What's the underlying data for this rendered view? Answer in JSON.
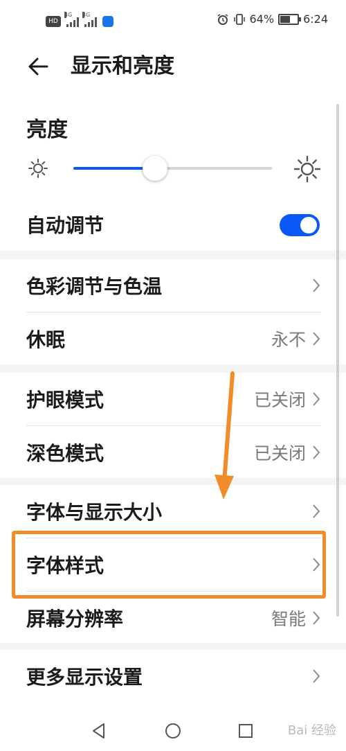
{
  "status_bar": {
    "hd_badge": "HD",
    "sim1_label": "4G",
    "sim2_label": "4G",
    "battery_percent": "64%",
    "battery_level": 0.64,
    "time": "6:24",
    "icons": [
      "hd-icon",
      "signal-icon",
      "signal-icon",
      "wifi-icon",
      "alarm-icon",
      "vibrate-icon",
      "battery-icon"
    ]
  },
  "header": {
    "title": "显示和亮度",
    "back_icon": "arrow-left-icon"
  },
  "brightness": {
    "label": "亮度",
    "level": 0.41,
    "auto_label": "自动调节",
    "auto_enabled": true
  },
  "groups": [
    {
      "items": [
        {
          "label": "色彩调节与色温",
          "value": ""
        },
        {
          "label": "休眠",
          "value": "永不"
        }
      ]
    },
    {
      "items": [
        {
          "label": "护眼模式",
          "value": "已关闭"
        },
        {
          "label": "深色模式",
          "value": "已关闭"
        }
      ]
    },
    {
      "items": [
        {
          "label": "字体与显示大小",
          "value": ""
        },
        {
          "label": "字体样式",
          "value": ""
        },
        {
          "label": "屏幕分辨率",
          "value": "智能"
        }
      ]
    },
    {
      "items": [
        {
          "label": "更多显示设置",
          "value": ""
        }
      ]
    }
  ],
  "colors": {
    "accent": "#0a59f7",
    "highlight": "#f28c28",
    "background": "#f1f3f5"
  },
  "watermark": "Bai 经验"
}
